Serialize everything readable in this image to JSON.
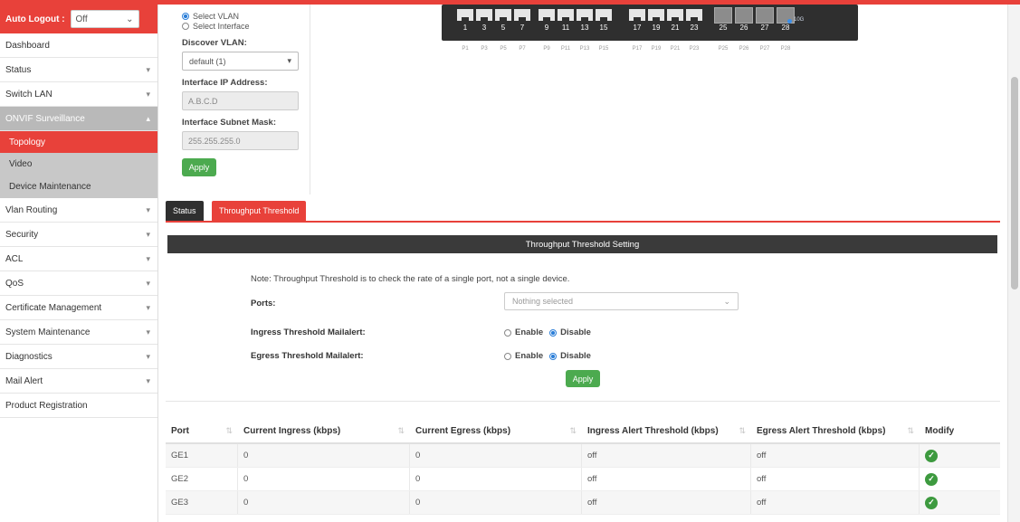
{
  "colors": {
    "accent": "#e8413a",
    "dark": "#2f2f2f",
    "green": "#4caa4f"
  },
  "sidebar": {
    "logout_label": "Auto Logout :",
    "logout_value": "Off",
    "items": [
      {
        "label": "Dashboard",
        "arrow": ""
      },
      {
        "label": "Status",
        "arrow": "▾"
      },
      {
        "label": "Switch LAN",
        "arrow": "▾"
      },
      {
        "label": "ONVIF Surveillance",
        "arrow": "▴"
      },
      {
        "label": "Topology",
        "arrow": ""
      },
      {
        "label": "Video",
        "arrow": ""
      },
      {
        "label": "Device Maintenance",
        "arrow": ""
      },
      {
        "label": "Vlan Routing",
        "arrow": "▾"
      },
      {
        "label": "Security",
        "arrow": "▾"
      },
      {
        "label": "ACL",
        "arrow": "▾"
      },
      {
        "label": "QoS",
        "arrow": "▾"
      },
      {
        "label": "Certificate Management",
        "arrow": "▾"
      },
      {
        "label": "System Maintenance",
        "arrow": "▾"
      },
      {
        "label": "Diagnostics",
        "arrow": "▾"
      },
      {
        "label": "Mail Alert",
        "arrow": "▾"
      },
      {
        "label": "Product Registration",
        "arrow": ""
      }
    ]
  },
  "discover_form": {
    "radio_vlan": "Select VLAN",
    "radio_interface": "Select Interface",
    "discover_vlan_label": "Discover VLAN:",
    "discover_vlan_value": "default (1)",
    "ip_label": "Interface IP Address:",
    "ip_placeholder": "A.B.C.D",
    "mask_label": "Interface Subnet Mask:",
    "mask_placeholder": "255.255.255.0",
    "apply": "Apply"
  },
  "switch_panel": {
    "port_numbers": [
      "1",
      "3",
      "5",
      "7",
      "9",
      "11",
      "13",
      "15",
      "17",
      "19",
      "21",
      "23",
      "25",
      "26",
      "27",
      "28"
    ],
    "port_labels": [
      "P1",
      "P3",
      "P5",
      "P7",
      "P9",
      "P11",
      "P13",
      "P15",
      "P17",
      "P19",
      "P21",
      "P23",
      "P25",
      "P26",
      "P27",
      "P28"
    ],
    "legend": "10G"
  },
  "tabs": {
    "status": "Status",
    "throughput": "Throughput Threshold"
  },
  "threshold": {
    "header": "Throughput Threshold Setting",
    "note": "Note: Throughput Threshold is to check the rate of a single port, not a single device.",
    "ports_label": "Ports:",
    "ports_placeholder": "Nothing selected",
    "ingress_label": "Ingress Threshold Mailalert:",
    "egress_label": "Egress Threshold Mailalert:",
    "enable": "Enable",
    "disable": "Disable",
    "apply": "Apply"
  },
  "table": {
    "headers": [
      "Port",
      "Current Ingress (kbps)",
      "Current Egress (kbps)",
      "Ingress Alert Threshold (kbps)",
      "Egress Alert Threshold (kbps)",
      "Modify"
    ],
    "rows": [
      [
        "GE1",
        "0",
        "0",
        "off",
        "off"
      ],
      [
        "GE2",
        "0",
        "0",
        "off",
        "off"
      ],
      [
        "GE3",
        "0",
        "0",
        "off",
        "off"
      ]
    ]
  }
}
